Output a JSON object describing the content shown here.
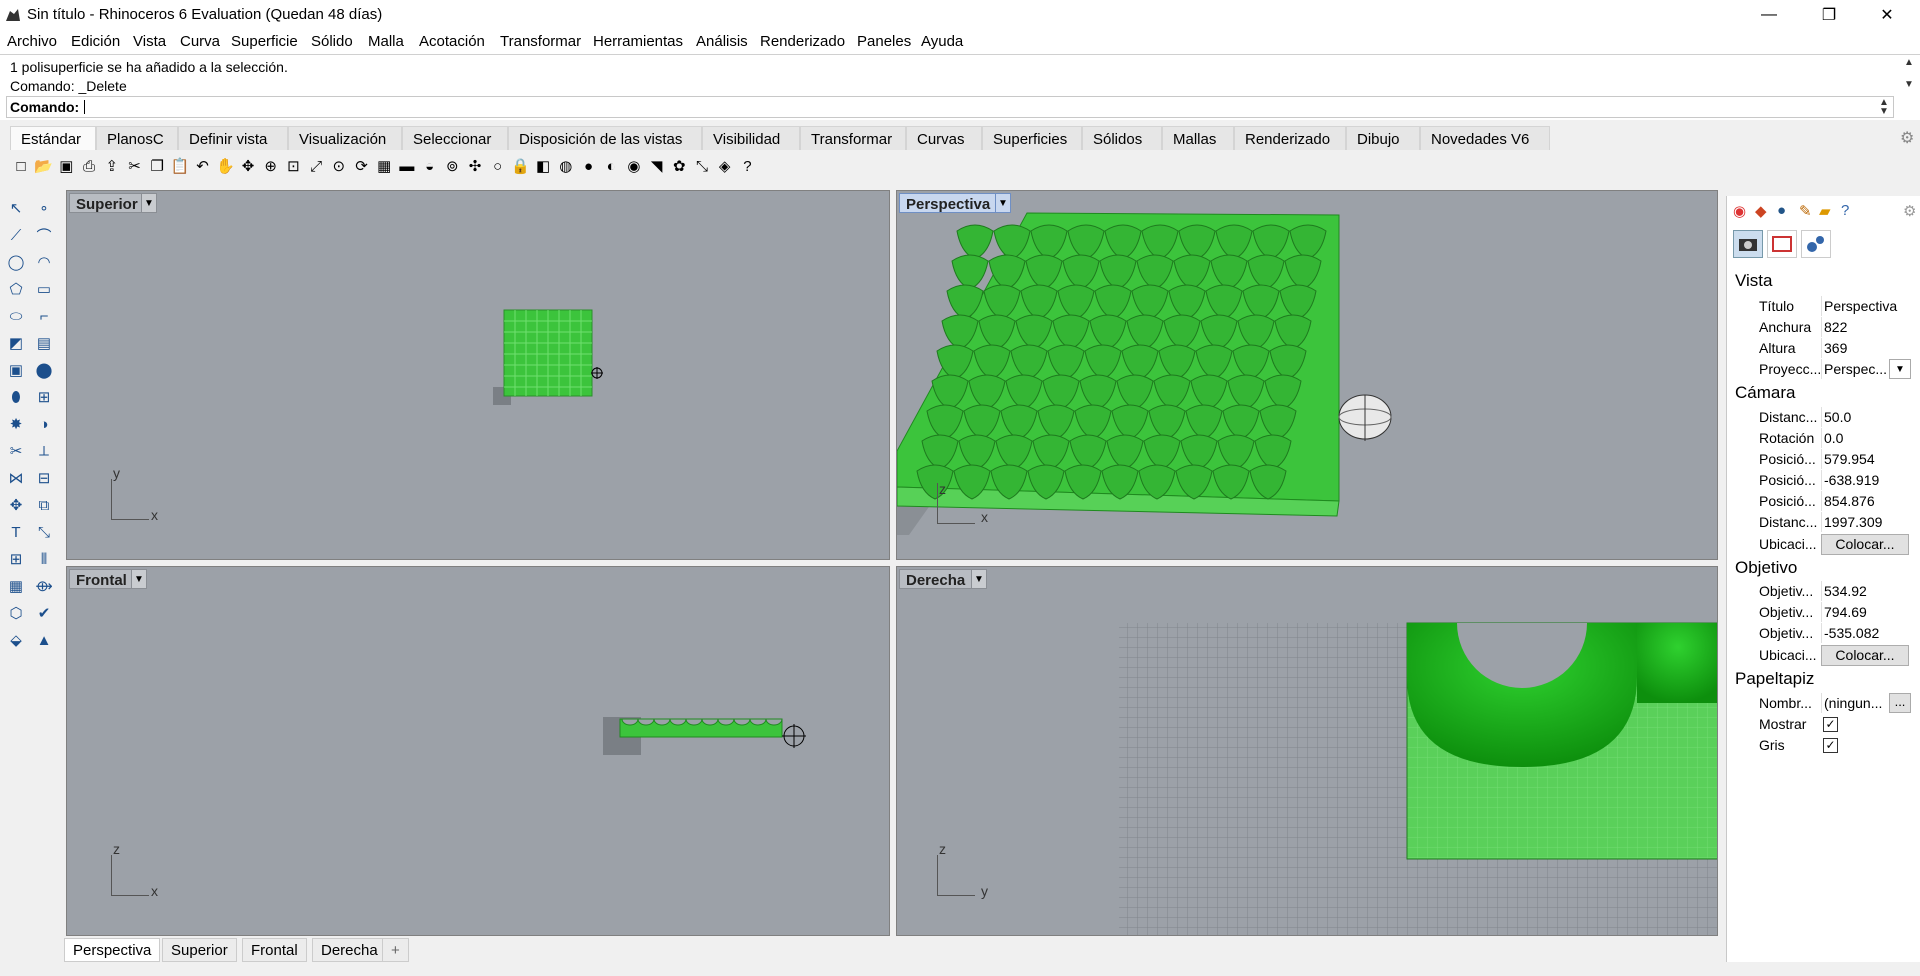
{
  "window": {
    "title": "Sin título - Rhinoceros 6 Evaluation (Quedan 48 días)",
    "minimize": "—",
    "restore": "❐",
    "close": "✕"
  },
  "menu": [
    "Archivo",
    "Edición",
    "Vista",
    "Curva",
    "Superficie",
    "Sólido",
    "Malla",
    "Acotación",
    "Transformar",
    "Herramientas",
    "Análisis",
    "Renderizado",
    "Paneles",
    "Ayuda"
  ],
  "command": {
    "history": [
      "1 polisuperficie se ha añadido a la selección.",
      "Comando: _Delete"
    ],
    "prompt": "Comando:",
    "value": ""
  },
  "tabs": [
    "Estándar",
    "PlanosC",
    "Definir vista",
    "Visualización",
    "Seleccionar",
    "Disposición de las vistas",
    "Visibilidad",
    "Transformar",
    "Curvas",
    "Superficies",
    "Sólidos",
    "Mallas",
    "Renderizado",
    "Dibujo",
    "Novedades V6"
  ],
  "toolbar_icons": [
    "new-file-icon",
    "open-icon",
    "save-icon",
    "print-icon",
    "import-icon",
    "cut-icon",
    "copy-icon",
    "paste-icon",
    "undo-icon",
    "pan-icon",
    "rotate-view-icon",
    "zoom-icon",
    "zoom-window-icon",
    "zoom-extents-icon",
    "zoom-selected-icon",
    "rotate-icon",
    "four-viewports-icon",
    "car-icon",
    "mouse-icon",
    "osnap-icon",
    "gumball-icon",
    "light-icon",
    "lock-icon",
    "layer-icon",
    "color-icon",
    "render-sphere-icon",
    "shaded-sphere-icon",
    "rendered-sphere-icon",
    "paint-icon",
    "gear-icon",
    "dimension-icon",
    "grasshopper-icon",
    "help-icon"
  ],
  "left_tools": [
    "select-icon",
    "point-icon",
    "polyline-icon",
    "curve-icon",
    "circle-icon",
    "arc-icon",
    "polygon-icon",
    "rectangle-icon",
    "ellipse-icon",
    "fillet-icon",
    "surface-icon",
    "extrude-icon",
    "box-icon",
    "sphere-icon",
    "cylinder-icon",
    "mesh-icon",
    "explode-icon",
    "boolean-icon",
    "trim-icon",
    "split-icon",
    "join-icon",
    "group-icon",
    "move-icon",
    "copy-tool-icon",
    "text-icon",
    "dimension-tool-icon",
    "array-icon",
    "align-icon",
    "grid-icon",
    "transform-icon",
    "clipping-icon",
    "check-icon",
    "paint-tool-icon",
    "light-tool-icon"
  ],
  "viewports": {
    "top": {
      "label": "Superior",
      "ax1": "y",
      "ax2": "x"
    },
    "perspective": {
      "label": "Perspectiva",
      "ax1": "z",
      "ax2": "x"
    },
    "front": {
      "label": "Frontal",
      "ax1": "z",
      "ax2": "x"
    },
    "right": {
      "label": "Derecha",
      "ax1": "z",
      "ax2": "y"
    }
  },
  "bottom_tabs": [
    "Perspectiva",
    "Superior",
    "Frontal",
    "Derecha"
  ],
  "add_tab": "+",
  "panel": {
    "vista": {
      "title": "Vista",
      "rows": [
        {
          "k": "Título",
          "v": "Perspectiva"
        },
        {
          "k": "Anchura",
          "v": "822"
        },
        {
          "k": "Altura",
          "v": "369"
        },
        {
          "k": "Proyecc...",
          "v": "Perspec..."
        }
      ]
    },
    "camara": {
      "title": "Cámara",
      "rows": [
        {
          "k": "Distanc...",
          "v": "50.0"
        },
        {
          "k": "Rotación",
          "v": "0.0"
        },
        {
          "k": "Posició...",
          "v": "579.954"
        },
        {
          "k": "Posició...",
          "v": "-638.919"
        },
        {
          "k": "Posició...",
          "v": "854.876"
        },
        {
          "k": "Distanc...",
          "v": "1997.309"
        }
      ],
      "loc_label": "Ubicaci...",
      "loc_btn": "Colocar..."
    },
    "objetivo": {
      "title": "Objetivo",
      "rows": [
        {
          "k": "Objetiv...",
          "v": "534.92"
        },
        {
          "k": "Objetiv...",
          "v": "794.69"
        },
        {
          "k": "Objetiv...",
          "v": "-535.082"
        }
      ],
      "loc_label": "Ubicaci...",
      "loc_btn": "Colocar..."
    },
    "papel": {
      "title": "Papeltapiz",
      "name_label": "Nombr...",
      "name_value": "(ningun...",
      "name_btn": "...",
      "show_label": "Mostrar",
      "show_checked": true,
      "gray_label": "Gris",
      "gray_checked": true
    }
  },
  "colors": {
    "accent_green": "#3cc43c",
    "viewport_bg": "#9ca1a8"
  }
}
